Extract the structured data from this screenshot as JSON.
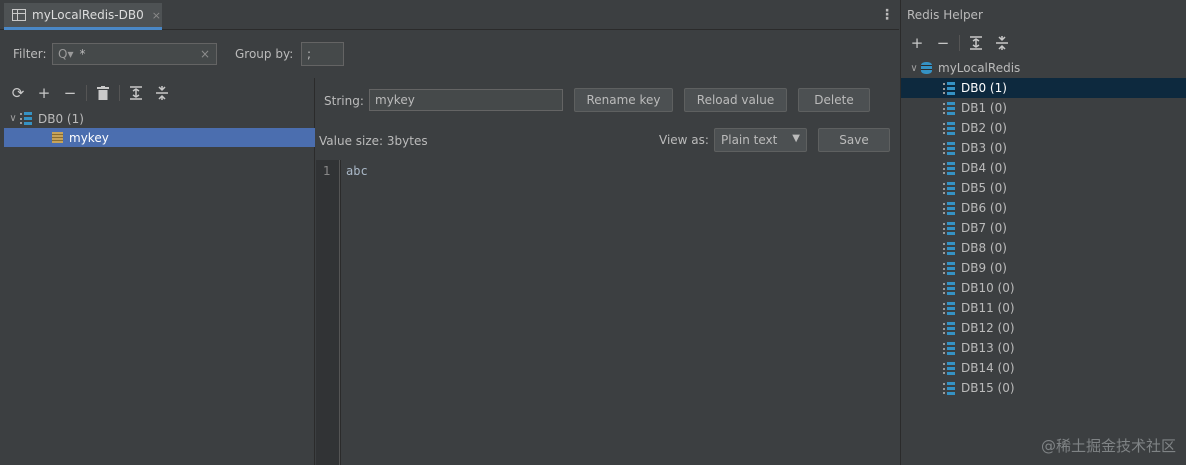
{
  "main": {
    "tab": {
      "label": "myLocalRedis-DB0",
      "close": "×"
    },
    "more_menu": "⋮",
    "filter": {
      "label": "Filter:",
      "search_glyph": "Q▾",
      "value": "*",
      "clear": "×"
    },
    "group_by": {
      "label": "Group by:",
      "value": ";"
    },
    "key_tree": {
      "database": {
        "label": "DB0 (1)"
      },
      "keys": [
        {
          "label": "mykey"
        }
      ]
    },
    "editor": {
      "string_label": "String:",
      "key_value": "mykey",
      "rename_button": "Rename key",
      "reload_button": "Reload value",
      "delete_button": "Delete",
      "value_size": "Value size: 3bytes",
      "view_as_label": "View as:",
      "view_as_value": "Plain text",
      "save_button": "Save",
      "line_number": "1",
      "content": "abc"
    }
  },
  "helper": {
    "title": "Redis Helper",
    "connection": "myLocalRedis",
    "databases": [
      "DB0 (1)",
      "DB1 (0)",
      "DB2 (0)",
      "DB3 (0)",
      "DB4 (0)",
      "DB5 (0)",
      "DB6 (0)",
      "DB7 (0)",
      "DB8 (0)",
      "DB9 (0)",
      "DB10 (0)",
      "DB11 (0)",
      "DB12 (0)",
      "DB13 (0)",
      "DB14 (0)",
      "DB15 (0)"
    ]
  },
  "watermark": "@稀土掘金技术社区",
  "colors": {
    "background": "#3c3f41",
    "selection": "#4b6eaf",
    "helper_selection": "#0d293e",
    "accent": "#3592c4"
  }
}
